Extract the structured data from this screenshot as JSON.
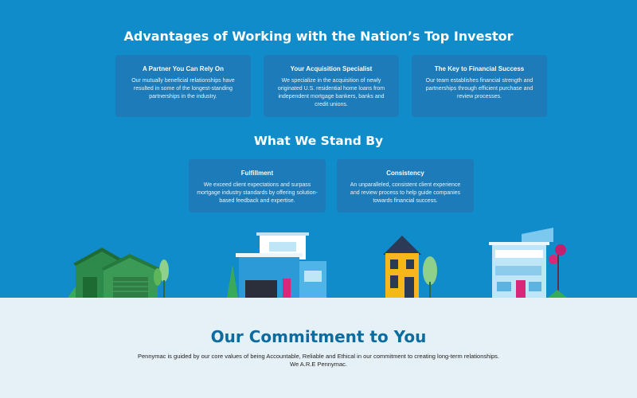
{
  "advantages": {
    "heading": "Advantages of Working with the Nation’s Top Investor",
    "cards": [
      {
        "title": "A Partner You Can Rely On",
        "body": "Our mutually beneficial relationships have resulted in some of the longest-standing partnerships in the industry."
      },
      {
        "title": "Your Acquisition Specialist",
        "body": "We specialize in the acquisition of newly originated U.S. residential home loans from independent mortgage bankers, banks and credit unions."
      },
      {
        "title": "The Key to Financial Success",
        "body": "Our team establishes financial strength and partnerships through efficient purchase and review processes."
      }
    ]
  },
  "stand": {
    "heading": "What We Stand By",
    "cards": [
      {
        "title": "Fulfillment",
        "body": "We exceed client expectations and surpass mortgage industry standards by offering solution-based feedback and expertise."
      },
      {
        "title": "Consistency",
        "body": "An unparalleled, consistent client experience and review process to help guide companies towards financial success."
      }
    ]
  },
  "commitment": {
    "title": "Our Commitment to You",
    "line1": "Pennymac is guided by our core values of being Accountable, Reliable and Ethical in our commitment to creating long-term relationships.",
    "line2": "We A.R.E Pennymac."
  },
  "colors": {
    "hero_bg": "#0f8cc9",
    "card_bg": "#2a6ea8",
    "commitment_bg": "#e6f1f7",
    "title_blue": "#0d6c9e"
  },
  "illustration": {
    "icons": [
      "green-barn-house-icon",
      "modern-blue-house-icon",
      "yellow-house-icon",
      "blue-townhouse-icon"
    ]
  }
}
